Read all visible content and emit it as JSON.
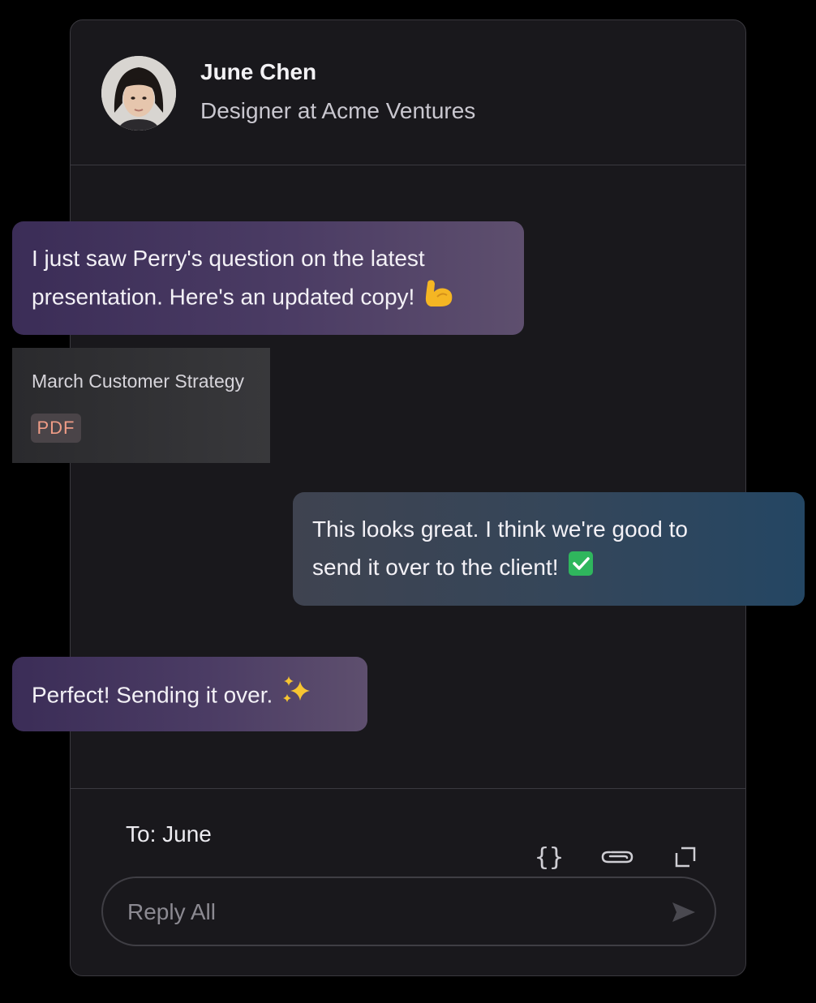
{
  "header": {
    "name": "June Chen",
    "role": "Designer at Acme Ventures"
  },
  "messages": [
    {
      "direction": "incoming",
      "lines": [
        "I just saw Perry's question on the latest",
        "presentation. Here's an updated copy!"
      ],
      "emoji": "flexed-biceps"
    },
    {
      "direction": "incoming",
      "type": "attachment",
      "filename": "March Customer Strategy",
      "filetype": "PDF"
    },
    {
      "direction": "outgoing",
      "lines": [
        "This looks great. I think we're good to",
        "send it over to the client!"
      ],
      "emoji": "check-mark-button"
    },
    {
      "direction": "incoming",
      "lines": [
        "Perfect! Sending it over."
      ],
      "emoji": "sparkles"
    }
  ],
  "composer": {
    "to_label": "To: June",
    "placeholder": "Reply All",
    "tools": [
      "code-braces-icon",
      "paperclip-icon",
      "expand-icon"
    ]
  },
  "colors": {
    "background": "#000000",
    "panel": "#19181c",
    "incoming_bubble": "#4b3c64",
    "outgoing_bubble": "#34465a",
    "pdf_badge_text": "#ef9c86"
  }
}
